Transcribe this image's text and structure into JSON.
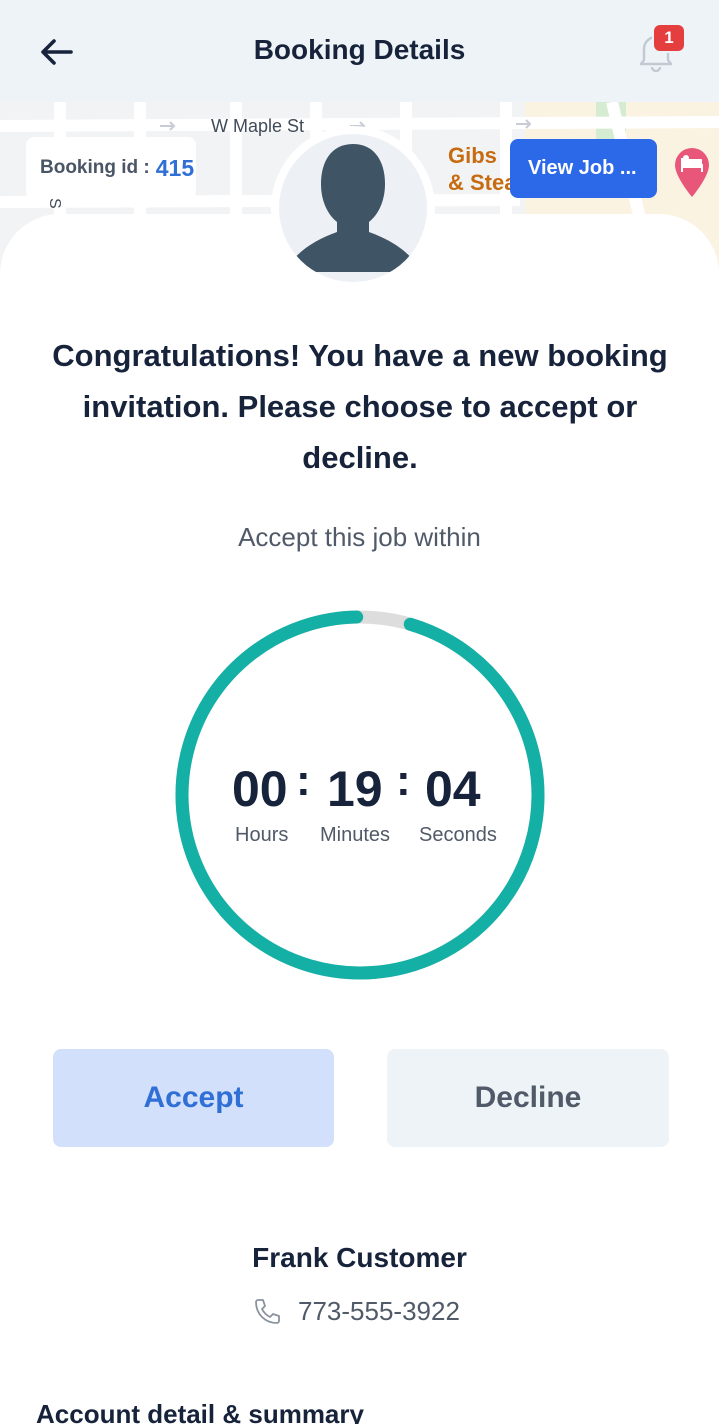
{
  "header": {
    "title": "Booking Details",
    "notification_count": "1"
  },
  "map": {
    "street_label": "W Maple St",
    "poi_line1": "Gibs",
    "poi_line2": "& Stea",
    "side_street": "S"
  },
  "booking": {
    "id_label": "Booking id :",
    "id_value": "415",
    "view_job_label": "View Job ..."
  },
  "message": {
    "text": "Congratulations! You have a new booking invitation. Please choose to accept or decline."
  },
  "timer": {
    "caption": "Accept this job within",
    "hours": "00",
    "minutes": "19",
    "seconds": "04",
    "separator": ":",
    "hours_label": "Hours",
    "minutes_label": "Minutes",
    "seconds_label": "Seconds",
    "remaining_fraction": 0.96,
    "ring_color": "#14b0a5",
    "track_color": "#dddddd"
  },
  "actions": {
    "accept_label": "Accept",
    "decline_label": "Decline"
  },
  "customer": {
    "name": "Frank Customer",
    "phone": "773-555-3922"
  },
  "sections": {
    "account_title": "Account detail & summary"
  },
  "icons": {
    "back": "back-arrow-icon",
    "bell": "bell-icon",
    "phone": "phone-icon",
    "pin": "hotel-pin-icon",
    "avatar": "user-avatar-icon"
  }
}
